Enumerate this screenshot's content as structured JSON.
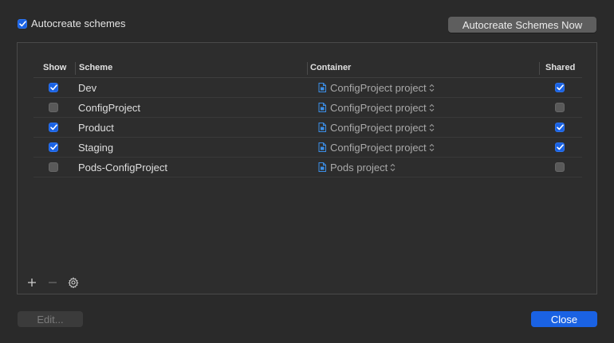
{
  "autocreate": {
    "label": "Autocreate schemes",
    "checked": true
  },
  "buttons": {
    "autocreate_now": "Autocreate Schemes Now",
    "edit": "Edit...",
    "close": "Close"
  },
  "table": {
    "headers": {
      "show": "Show",
      "scheme": "Scheme",
      "container": "Container",
      "shared": "Shared"
    },
    "rows": [
      {
        "show": true,
        "scheme": "Dev",
        "container": "ConfigProject project",
        "shared": true
      },
      {
        "show": false,
        "scheme": "ConfigProject",
        "container": "ConfigProject project",
        "shared": false
      },
      {
        "show": true,
        "scheme": "Product",
        "container": "ConfigProject project",
        "shared": true
      },
      {
        "show": true,
        "scheme": "Staging",
        "container": "ConfigProject project",
        "shared": true
      },
      {
        "show": false,
        "scheme": "Pods-ConfigProject",
        "container": "Pods project",
        "shared": false
      }
    ]
  },
  "tools": [
    "plus-icon",
    "minus-icon",
    "gear-icon"
  ],
  "colors": {
    "accent": "#1a62e3",
    "background": "#2a2a2a"
  }
}
